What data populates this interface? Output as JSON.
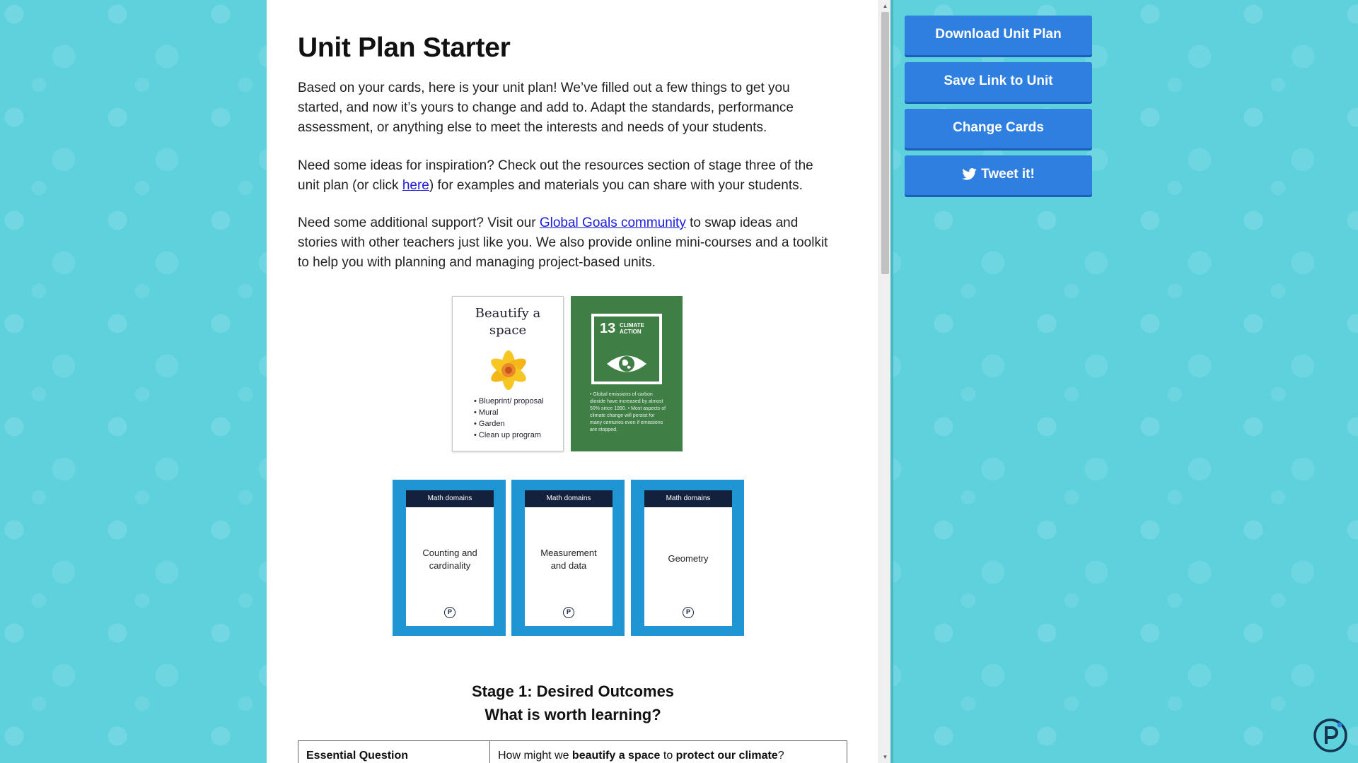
{
  "page": {
    "title": "Unit Plan Starter",
    "intro": "Based on your cards, here is your unit plan! We’ve filled out a few things to get you started, and now it’s yours to change and add to. Adapt the standards, performance assessment, or anything else to meet the interests and needs of your students.",
    "inspiration_pre": "Need some ideas for inspiration? Check out the resources section of stage three of the unit plan (or click ",
    "inspiration_link": "here",
    "inspiration_post": ") for examples and materials you can share with your students.",
    "support_pre": "Need some additional support? Visit our ",
    "support_link": "Global Goals community",
    "support_post": " to swap ideas and stories with other teachers just like you. We also provide online mini-courses and a toolkit to help you with planning and managing project-based units."
  },
  "cards": {
    "beautify": {
      "title": "Beautify a space",
      "items": [
        "Blueprint/ proposal",
        "Mural",
        "Garden",
        "Clean up program"
      ]
    },
    "climate": {
      "number": "13",
      "label_line1": "CLIMATE",
      "label_line2": "ACTION",
      "text": "• Global emissions of carbon dioxide have increased by almost 50% since 1990. • Most aspects of climate change will persist for many centuries even if emissions are stopped."
    },
    "math": [
      {
        "header": "Math domains",
        "label": "Counting and cardinality"
      },
      {
        "header": "Math domains",
        "label": "Measurement and data"
      },
      {
        "header": "Math domains",
        "label": "Geometry"
      }
    ],
    "logo_letter": "P"
  },
  "stage1": {
    "heading": "Stage 1: Desired Outcomes",
    "subheading": "What is worth learning?",
    "row_label": "Essential Question",
    "q_pre": "How might we ",
    "q_b1": "beautify a space",
    "q_mid": " to ",
    "q_b2": "protect our climate",
    "q_post": "?"
  },
  "sidebar": {
    "download": "Download Unit Plan",
    "save": "Save Link to Unit",
    "change": "Change Cards",
    "tweet": "Tweet it!"
  },
  "colors": {
    "background": "#5dd1dc",
    "button": "#2f7fe0",
    "climate_green": "#3f7e44",
    "math_blue": "#1f95d4"
  }
}
